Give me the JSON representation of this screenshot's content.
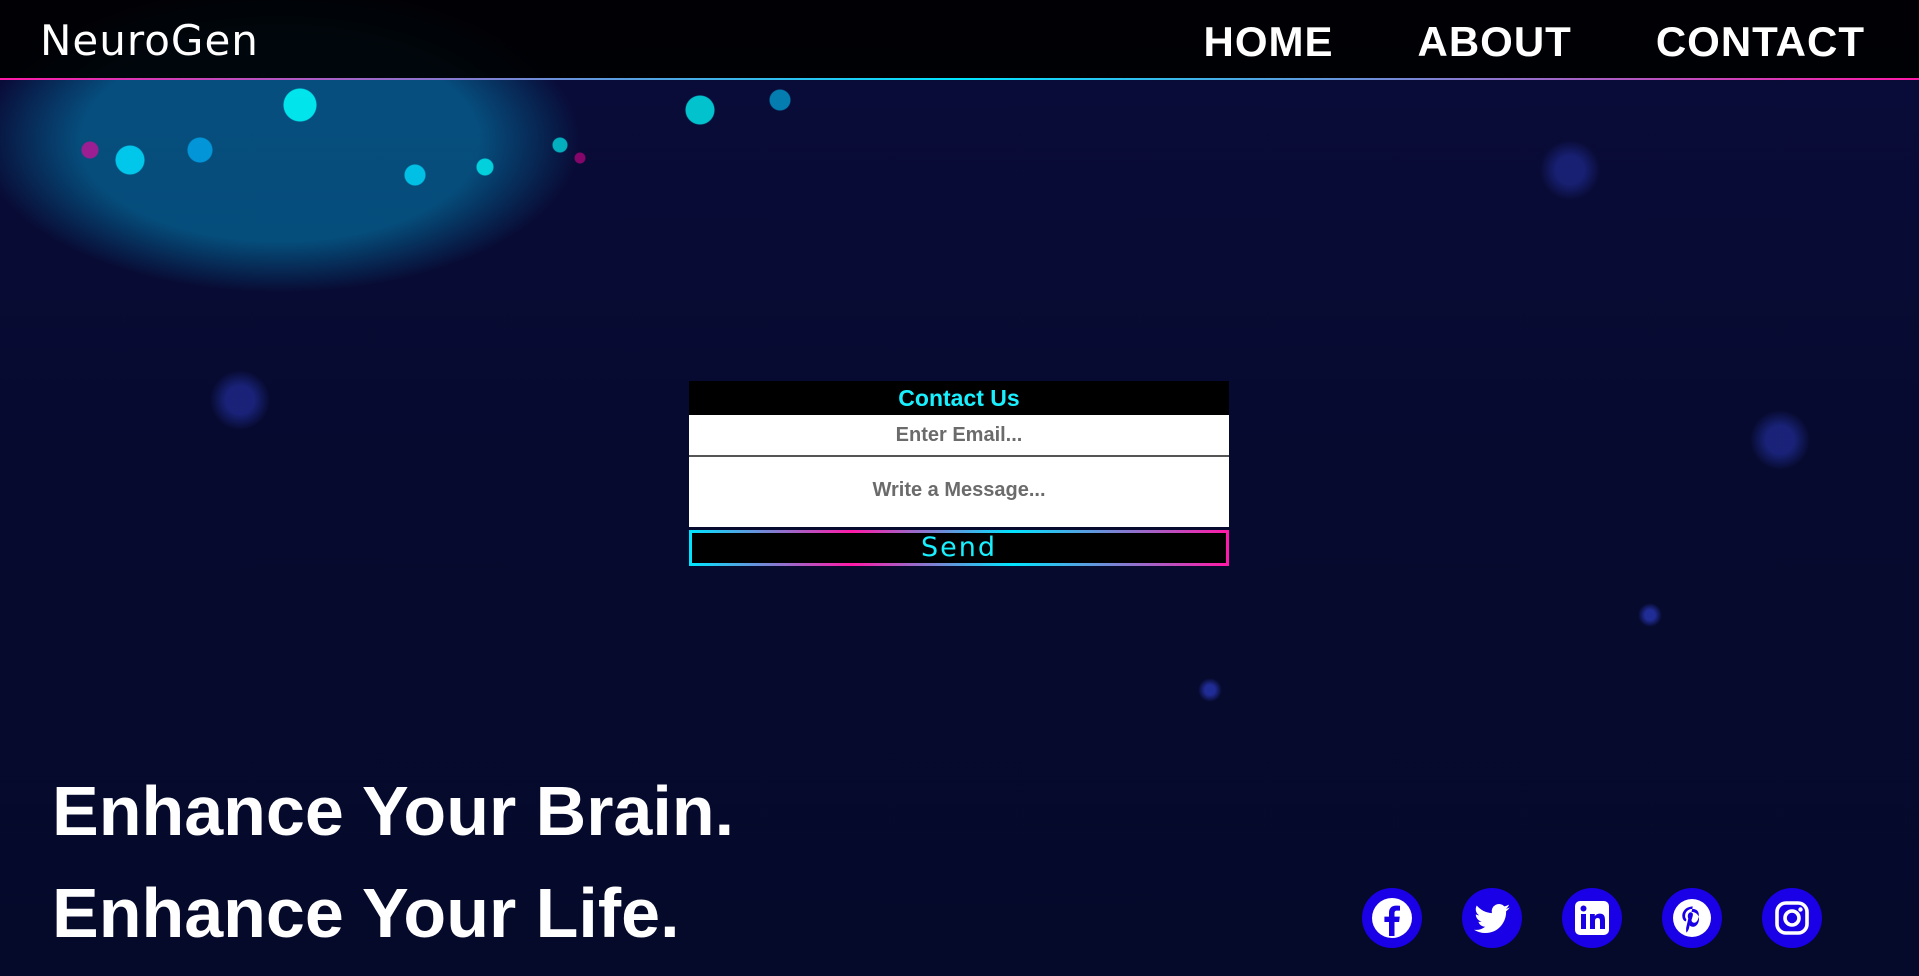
{
  "header": {
    "logo": "NeuroGen",
    "nav": [
      {
        "label": "HOME"
      },
      {
        "label": "ABOUT"
      },
      {
        "label": "CONTACT"
      }
    ]
  },
  "contact": {
    "title": "Contact Us",
    "email_placeholder": "Enter Email...",
    "message_placeholder": "Write a Message...",
    "send_label": "Send"
  },
  "hero": {
    "line1": "Enhance Your Brain.",
    "line2": "Enhance Your Life."
  },
  "socials": [
    {
      "icon": "facebook-icon"
    },
    {
      "icon": "twitter-icon"
    },
    {
      "icon": "linkedin-icon"
    },
    {
      "icon": "pinterest-icon"
    },
    {
      "icon": "instagram-icon"
    }
  ],
  "colors": {
    "accent_cyan": "#19f0ff",
    "accent_magenta": "#ff1aa8",
    "social_blue": "#1a00e6"
  }
}
